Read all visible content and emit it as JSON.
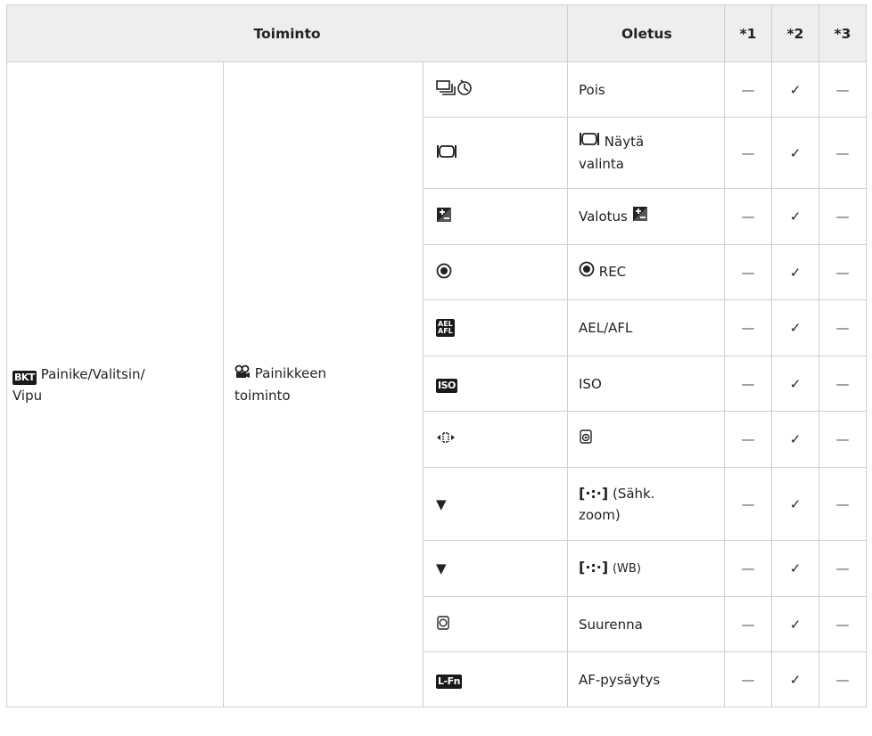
{
  "headers": {
    "toiminto": "Toiminto",
    "oletus": "Oletus",
    "c1": "*1",
    "c2": "*2",
    "c3": "*3"
  },
  "func_label": "Painike/Valitsin/\nVipu",
  "func_badge": "BKT",
  "sub_label": "Painikkeen\ntoiminto",
  "rows": [
    {
      "icon": "drive-self-timer-icon",
      "default": "Pois",
      "c1": "—",
      "c2": "✓",
      "c3": "—"
    },
    {
      "icon": "live-view-frame-icon",
      "default": "Näytä\nvalinta",
      "default_icon": "live-view-frame-icon",
      "c1": "—",
      "c2": "✓",
      "c3": "—"
    },
    {
      "icon": "exposure-compensation-icon",
      "default": "Valotus",
      "default_icon_after": "exposure-compensation-icon",
      "c1": "—",
      "c2": "✓",
      "c3": "—"
    },
    {
      "icon": "record-icon",
      "default": "REC",
      "default_icon": "record-icon",
      "c1": "—",
      "c2": "✓",
      "c3": "—"
    },
    {
      "icon": "ael-afl-icon",
      "default": "AEL/AFL",
      "c1": "—",
      "c2": "✓",
      "c3": "—"
    },
    {
      "icon": "iso-icon",
      "default": "ISO",
      "c1": "—",
      "c2": "✓",
      "c3": "—"
    },
    {
      "icon": "four-way-arrows-icon",
      "default": "",
      "default_icon": "magnify-knob-icon",
      "c1": "—",
      "c2": "✓",
      "c3": "—"
    },
    {
      "icon": "down-triangle-icon",
      "default": "(Sähk.\nzoom)",
      "default_icon": "af-target-bracket-icon",
      "c1": "—",
      "c2": "✓",
      "c3": "—"
    },
    {
      "icon": "down-triangle-icon",
      "default": "(WB)",
      "default_icon": "af-target-bracket-icon",
      "c1": "—",
      "c2": "✓",
      "c3": "—"
    },
    {
      "icon": "magnify-icon",
      "default": "Suurenna",
      "c1": "—",
      "c2": "✓",
      "c3": "—"
    },
    {
      "icon": "l-fn-icon",
      "default": "AF-pysäytys",
      "c1": "—",
      "c2": "✓",
      "c3": "—"
    }
  ],
  "badges": {
    "ael_top": "AEL",
    "ael_bottom": "AFL",
    "iso": "ISO",
    "lfn": "L-Fn",
    "bracket": "[·:·]"
  }
}
